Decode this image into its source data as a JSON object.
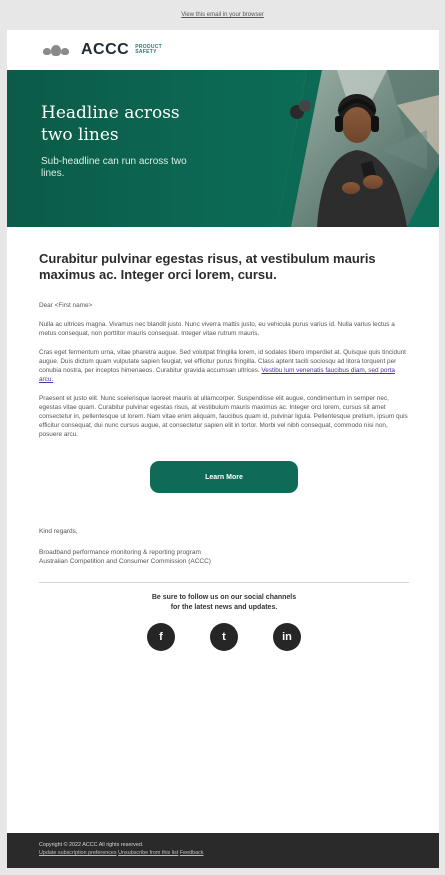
{
  "topbar": {
    "view_in_browser": "View this email in your browser"
  },
  "brand": {
    "name": "ACCC",
    "sub_line1": "PRODUCT",
    "sub_line2": "SAFETY",
    "crest_icon": "coat-of-arms-icon"
  },
  "hero": {
    "headline_line1": "Headline across",
    "headline_line2": "two lines",
    "subheadline": "Sub-headline can run across two lines.",
    "photo_icon": "person-using-phone-photo"
  },
  "body": {
    "title": "Curabitur pulvinar egestas risus, at vestibulum mauris maximus ac. Integer orci lorem, cursu.",
    "greeting": "Dear <First name>",
    "para1": "Nulla ac ultrices magna. Vivamus nec blandit justo. Nunc viverra mattis justo, eu vehicula purus varius id. Nulla varius lectus a metus consequat, non porttitor mauris consequat. Integer vitae rutrum mauris.",
    "para2": "Cras eget fermentum urna, vitae pharetra augue. Sed volutpat fringilla lorem, id sodales libero imperdiet at. Quisque quis tincidunt augue. Duis dictum quam vulputate sapien feugiat, vel efficitur purus fringilla. Class aptent taciti sociosqu ad litora torquent per conubia nostra, per inceptos himenaeos. Curabitur gravida accumsan ultrices.",
    "para2_link": "Vestibu lum venenatis faucibus diam, sed porta arcu.",
    "para3": "Praesent et justo elit. Nunc scelerisque laoreet mauris at ullamcorper. Suspendisse elit augue, condimentum in semper nec, egestas vitae quam. Curabitur pulvinar egestas risus, at vestibulum mauris maximus ac. Integer orci lorem, cursus sit amet consectetur in, pellentesque ut lorem. Nam vitae enim aliquam, faucibus quam id, pulvinar ligula. Pellentesque pretium, ipsum quis efficitur consequat, dui nunc cursus augue, at consectetur sapien elit in tortor. Morbi vel nibh consequat, commodo nisi non, posuere arcu.",
    "cta_label": "Learn More",
    "regards": "Kind regards,",
    "sign_line1": "Broadband performance monitoring & reporting program",
    "sign_line2": "Australian Competition and Consumer Commission (ACCC)"
  },
  "social": {
    "heading_line1": "Be sure to follow us on our social channels",
    "heading_line2": "for the latest news and updates.",
    "icons": [
      {
        "name": "facebook-icon",
        "glyph": "f"
      },
      {
        "name": "twitter-icon",
        "glyph": "t"
      },
      {
        "name": "linkedin-icon",
        "glyph": "in"
      }
    ]
  },
  "footer": {
    "copyright": "Copyright © 2022 ACCC All rights reserved.",
    "link_update": "Update subscription preferences",
    "link_unsubscribe": "Unsubscribe from this list",
    "link_feedback": "Feedback"
  },
  "colors": {
    "brand_green": "#0f6b58",
    "hero_green": "#0c6a54",
    "link_purple": "#4b31a8",
    "footer_bg": "#2a2a2a"
  }
}
